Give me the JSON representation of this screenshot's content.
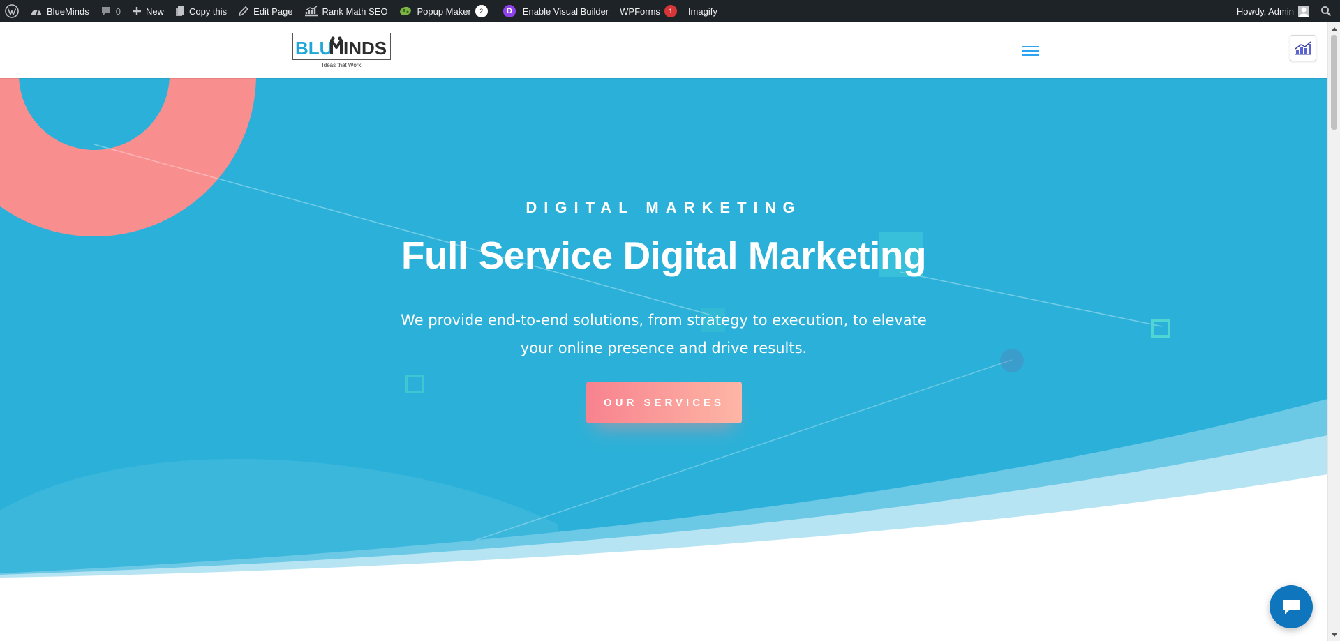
{
  "admin_bar": {
    "site_name": "BlueMinds",
    "comments_count": "0",
    "new_label": "New",
    "copy_label": "Copy this",
    "edit_label": "Edit Page",
    "rankmath_label": "Rank Math SEO",
    "popup_label": "Popup Maker",
    "popup_count": "2",
    "visual_builder_label": "Enable Visual Builder",
    "divi_letter": "D",
    "wpforms_label": "WPForms",
    "wpforms_count": "1",
    "imagify_label": "Imagify",
    "howdy_label": "Howdy, Admin",
    "colors": {
      "bar_bg": "#1d2327",
      "popup_badge": "#ffffff",
      "wpforms_badge": "#d63638",
      "divi": "#8f42ec"
    }
  },
  "header": {
    "logo_text_blue": "BLU",
    "logo_text_dark": "INDS",
    "logo_tagline": "Ideas that Work",
    "menu_icon": "hamburger-icon",
    "badge_icon": "bar-chart-icon"
  },
  "hero": {
    "kicker": "DIGITAL MARKETING",
    "title": "Full Service Digital Marketing",
    "subtitle": "We provide end-to-end solutions, from strategy to execution, to elevate your online presence and drive results.",
    "button_label": "OUR SERVICES",
    "colors": {
      "background": "#2bb1d9",
      "accent_pink": "#f98e8e",
      "button_start": "#f8828f",
      "button_end": "#fdb6a5"
    }
  },
  "chat": {
    "icon": "chat-icon"
  }
}
